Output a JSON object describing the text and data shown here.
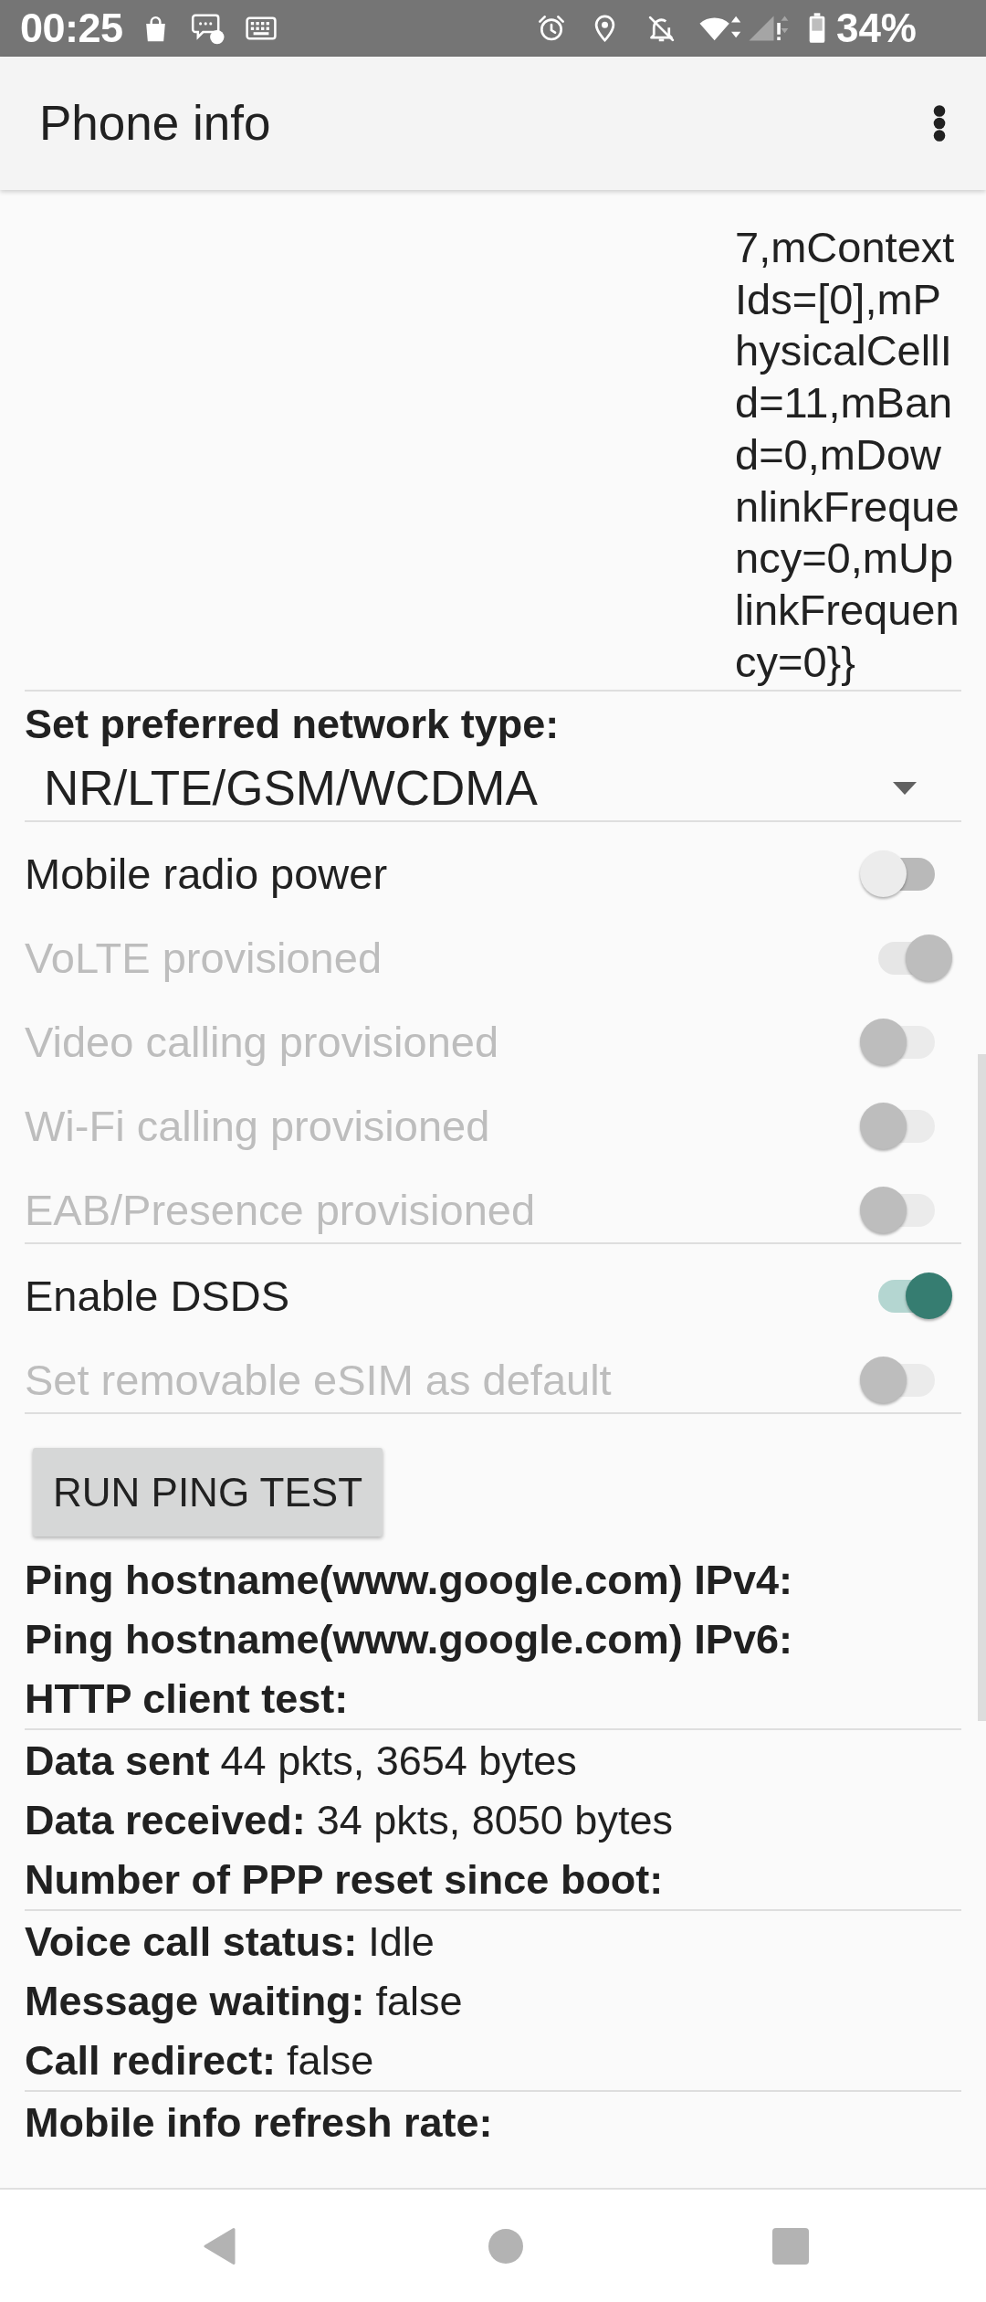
{
  "status_bar": {
    "time": "00:25",
    "battery": "34%"
  },
  "app_bar": {
    "title": "Phone info"
  },
  "cell_info": {
    "value": "7,mContextIds=[0],mPhysicalCellId=11,mBand=0,mDownlinkFrequency=0,mUplinkFrequency=0}}"
  },
  "preferred_network": {
    "label": "Set preferred network type:",
    "value": "NR/LTE/GSM/WCDMA"
  },
  "switch_groups": [
    {
      "switches": [
        {
          "label": "Mobile radio power",
          "on": false,
          "disabled": false
        },
        {
          "label": "VoLTE provisioned",
          "on": true,
          "disabled": true
        },
        {
          "label": "Video calling provisioned",
          "on": false,
          "disabled": true
        },
        {
          "label": "Wi-Fi calling provisioned",
          "on": false,
          "disabled": true
        },
        {
          "label": "EAB/Presence provisioned",
          "on": false,
          "disabled": true
        }
      ]
    },
    {
      "switches": [
        {
          "label": "Enable DSDS",
          "on": true,
          "disabled": false
        },
        {
          "label": "Set removable eSIM as default",
          "on": false,
          "disabled": true
        }
      ]
    }
  ],
  "ping_button": {
    "label": "RUN PING TEST"
  },
  "info_groups": [
    {
      "items": [
        {
          "label": "Ping hostname(www.google.com) IPv4:"
        },
        {
          "label": "Ping hostname(www.google.com) IPv6:"
        },
        {
          "label": "HTTP client test:"
        }
      ]
    },
    {
      "items": [
        {
          "label": "Data sent",
          "value": "44 pkts, 3654 bytes"
        },
        {
          "label": "Data received:",
          "value": "34 pkts, 8050 bytes"
        },
        {
          "label": "Number of PPP reset since boot:"
        }
      ]
    },
    {
      "items": [
        {
          "label": "Voice call status:",
          "value": "Idle"
        },
        {
          "label": "Message waiting:",
          "value": "false"
        },
        {
          "label": "Call redirect:",
          "value": "false"
        }
      ]
    },
    {
      "items": [
        {
          "label": "Mobile info refresh rate:"
        }
      ]
    }
  ]
}
